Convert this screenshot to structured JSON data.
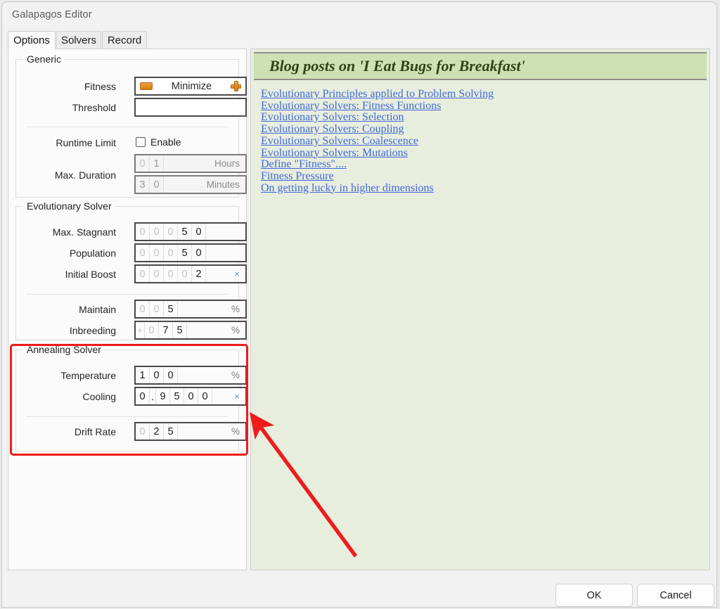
{
  "window": {
    "title": "Galapagos Editor"
  },
  "tabs": [
    {
      "label": "Options",
      "active": true
    },
    {
      "label": "Solvers",
      "active": false
    },
    {
      "label": "Record",
      "active": false
    }
  ],
  "generic": {
    "title": "Generic",
    "fitness": {
      "label": "Fitness",
      "value": "Minimize",
      "minus_icon": "minus-icon",
      "plus_icon": "plus-icon"
    },
    "threshold": {
      "label": "Threshold",
      "value": "",
      "placeholder": ""
    },
    "runtime_limit": {
      "label": "Runtime Limit",
      "checkbox_label": "Enable",
      "checked": false
    },
    "max_duration": {
      "label": "Max. Duration",
      "hours": {
        "digits": [
          "0",
          "1"
        ],
        "active_from": 1,
        "suffix": "Hours",
        "disabled": true
      },
      "minutes": {
        "digits": [
          "3",
          "0"
        ],
        "active_from": 0,
        "suffix": "Minutes",
        "disabled": true
      }
    }
  },
  "evolutionary_solver": {
    "title": "Evolutionary Solver",
    "rows": [
      {
        "label": "Max. Stagnant",
        "digits": [
          "0",
          "0",
          "0",
          "5",
          "0"
        ],
        "active_from": 3,
        "suffix": ""
      },
      {
        "label": "Population",
        "digits": [
          "0",
          "0",
          "0",
          "5",
          "0"
        ],
        "active_from": 3,
        "suffix": ""
      },
      {
        "label": "Initial Boost",
        "digits": [
          "0",
          "0",
          "0",
          "0",
          "2"
        ],
        "active_from": 4,
        "suffix": "×"
      },
      {
        "label": "Maintain",
        "digits": [
          "0",
          "0",
          "5"
        ],
        "active_from": 2,
        "suffix": "%"
      },
      {
        "label": "Inbreeding",
        "sign": "+",
        "digits": [
          "0",
          "7",
          "5"
        ],
        "active_from": 1,
        "suffix": "%"
      }
    ]
  },
  "annealing_solver": {
    "title": "Annealing Solver",
    "highlighted": true,
    "highlight_color": "#ee1c1c",
    "rows": [
      {
        "label": "Temperature",
        "digits": [
          "1",
          "0",
          "0"
        ],
        "active_from": 0,
        "suffix": "%"
      },
      {
        "label": "Cooling",
        "digits": [
          "0",
          ".",
          "9",
          "5",
          "0",
          "0"
        ],
        "active_from": 0,
        "suffix": "×"
      },
      {
        "label": "Drift Rate",
        "digits": [
          "0",
          "2",
          "5"
        ],
        "active_from": 1,
        "suffix": "%"
      }
    ]
  },
  "blog_panel": {
    "header": "Blog posts on 'I Eat Bugs for Breakfast'",
    "links": [
      "Evolutionary Principles applied to Problem Solving",
      "Evolutionary Solvers: Fitness Functions",
      "Evolutionary Solvers: Selection",
      "Evolutionary Solvers: Coupling",
      "Evolutionary Solvers: Coalescence",
      "Evolutionary Solvers: Mutations",
      "Define \"Fitness\"....",
      "Fitness Pressure",
      "On getting lucky in higher dimensions"
    ]
  },
  "footer": {
    "ok_label": "OK",
    "cancel_label": "Cancel"
  },
  "annotation": {
    "arrow_color": "#ee1c1c"
  }
}
